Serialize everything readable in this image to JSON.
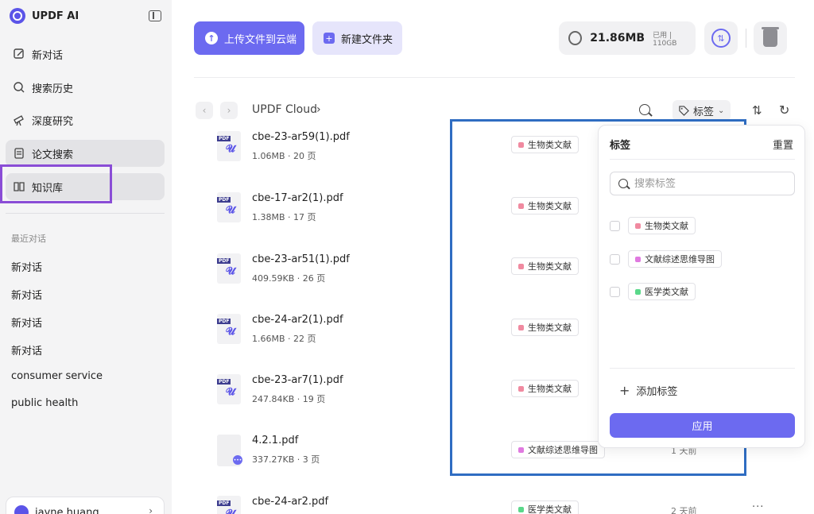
{
  "app": {
    "name": "UPDF AI"
  },
  "sidebar": {
    "nav": [
      {
        "label": "新对话",
        "icon": "edit-icon"
      },
      {
        "label": "搜索历史",
        "icon": "search-icon"
      },
      {
        "label": "深度研究",
        "icon": "telescope-icon"
      },
      {
        "label": "论文搜索",
        "icon": "paper-icon"
      },
      {
        "label": "知识库",
        "icon": "book-icon"
      }
    ],
    "recent_title": "最近对话",
    "recent": [
      "新对话",
      "新对话",
      "新对话",
      "新对话",
      "consumer service",
      "public health"
    ],
    "user_name": "jayne huang"
  },
  "toolbar": {
    "upload_label": "上传文件到云端",
    "new_folder_label": "新建文件夹",
    "storage_used": "21.86MB",
    "storage_used_label": "已用",
    "storage_total": "110GB"
  },
  "breadcrumb": {
    "root": "UPDF Cloud"
  },
  "filter": {
    "tag_label": "标签"
  },
  "files": [
    {
      "name": "cbe-23-ar59(1).pdf",
      "meta": "1.06MB · 20 页",
      "tag": "生物类文献",
      "tag_color": "#f08aa0",
      "type": "pdf"
    },
    {
      "name": "cbe-17-ar2(1).pdf",
      "meta": "1.38MB · 17 页",
      "tag": "生物类文献",
      "tag_color": "#f08aa0",
      "type": "pdf"
    },
    {
      "name": "cbe-23-ar51(1).pdf",
      "meta": "409.59KB · 26 页",
      "tag": "生物类文献",
      "tag_color": "#f08aa0",
      "type": "pdf"
    },
    {
      "name": "cbe-24-ar2(1).pdf",
      "meta": "1.66MB · 22 页",
      "tag": "生物类文献",
      "tag_color": "#f08aa0",
      "type": "pdf"
    },
    {
      "name": "cbe-23-ar7(1).pdf",
      "meta": "247.84KB · 19 页",
      "tag": "生物类文献",
      "tag_color": "#f08aa0",
      "type": "pdf"
    },
    {
      "name": "4.2.1.pdf",
      "meta": "337.27KB · 3 页",
      "tag": "文献综述思维导图",
      "tag_color": "#e07ae0",
      "type": "doc",
      "time": "1 天前"
    },
    {
      "name": "cbe-24-ar2.pdf",
      "meta": "",
      "tag": "医学类文献",
      "tag_color": "#5ad88a",
      "type": "pdf",
      "time": "2 天前"
    }
  ],
  "tag_panel": {
    "title": "标签",
    "reset": "重置",
    "search_placeholder": "搜索标签",
    "options": [
      {
        "label": "生物类文献",
        "color": "#f08aa0"
      },
      {
        "label": "文献综述思维导图",
        "color": "#e07ae0"
      },
      {
        "label": "医学类文献",
        "color": "#5ad88a"
      }
    ],
    "add_label": "添加标签",
    "apply_label": "应用"
  }
}
